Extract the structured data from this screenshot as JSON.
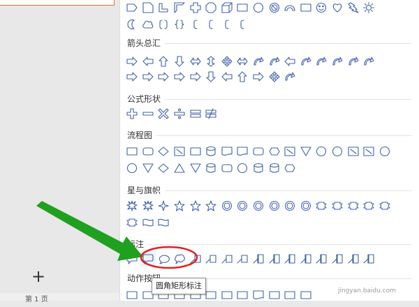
{
  "left_panel": {
    "add_label": "+",
    "bottom_text": "第 1 页"
  },
  "sections": [
    {
      "title": "",
      "rows": [
        [
          "rectangle-pentagon-icon",
          "snip-corner-icon",
          "l-shape-icon",
          "half-frame-icon",
          "cross-icon",
          "octagon-plaque-icon",
          "cube-icon",
          "bevel-icon",
          "donut-icon",
          "no-symbol-icon",
          "block-arc-icon",
          "folded-corner-icon",
          "smiley-icon",
          "heart-icon",
          "lightning-icon",
          "sun-icon"
        ],
        [
          "moon-icon",
          "cloud-icon",
          "double-bracket-icon",
          "double-brace-icon",
          "left-bracket-icon",
          "right-bracket-icon",
          "left-brace-icon",
          "right-brace-icon"
        ]
      ]
    },
    {
      "title": "箭头总汇",
      "rows": [
        [
          "right-arrow-icon",
          "left-arrow-icon",
          "up-arrow-icon",
          "down-arrow-icon",
          "left-right-arrow-icon",
          "up-down-arrow-icon",
          "quad-arrow-icon",
          "left-right-up-arrow-icon",
          "bent-arrow-icon",
          "u-turn-arrow-icon",
          "left-up-arrow-icon",
          "bent-up-arrow-icon",
          "curved-right-arrow-icon",
          "curved-left-arrow-icon",
          "curved-up-arrow-icon",
          "curved-down-arrow-icon"
        ],
        [
          "striped-right-arrow-icon",
          "notched-right-arrow-icon",
          "pentagon-arrow-icon",
          "chevron-arrow-icon",
          "right-callout-arrow-icon",
          "down-callout-arrow-icon",
          "left-callout-arrow-icon",
          "up-callout-arrow-icon",
          "left-right-callout-icon",
          "quad-callout-icon",
          "circular-arrow-icon"
        ]
      ]
    },
    {
      "title": "公式形状",
      "rows": [
        [
          "plus-icon",
          "minus-icon",
          "multiply-icon",
          "divide-icon",
          "equal-icon",
          "not-equal-icon"
        ]
      ]
    },
    {
      "title": "流程图",
      "rows": [
        [
          "process-icon",
          "alt-process-icon",
          "decision-icon",
          "data-icon",
          "predefined-process-icon",
          "internal-storage-icon",
          "document-icon",
          "multidocument-icon",
          "terminator-icon",
          "preparation-icon",
          "manual-input-icon",
          "manual-operation-icon",
          "connector-icon",
          "offpage-connector-icon",
          "punched-card-icon",
          "punched-tape-icon",
          "summing-junction-icon"
        ],
        [
          "or-icon",
          "collate-icon",
          "sort-icon",
          "extract-icon",
          "merge-icon",
          "stored-data-icon",
          "delay-icon",
          "sequential-storage-icon",
          "magnetic-disk-icon",
          "direct-storage-icon",
          "display-icon"
        ]
      ]
    },
    {
      "title": "星与旗帜",
      "rows": [
        [
          "explosion-1-icon",
          "explosion-2-icon",
          "star-4-icon",
          "star-5-icon",
          "star-6-icon",
          "star-7-icon",
          "star-8-icon",
          "star-10-icon",
          "star-12-icon",
          "star-16-icon",
          "star-24-icon",
          "star-32-icon",
          "ribbon-down-icon",
          "ribbon-up-icon",
          "curved-ribbon-down-icon",
          "curved-ribbon-up-icon",
          "vertical-scroll-icon"
        ],
        [
          "horizontal-scroll-icon",
          "wave-icon",
          "double-wave-icon"
        ]
      ]
    },
    {
      "title": "标注",
      "rows": [
        [
          "rect-callout-icon",
          "rounded-rect-callout-icon",
          "oval-callout-icon",
          "cloud-callout-icon",
          "line-callout-1-icon",
          "line-callout-2-icon",
          "line-callout-3-icon",
          "line-callout-4-icon",
          "accent-callout-1-icon",
          "accent-callout-2-icon",
          "accent-callout-3-icon",
          "accent-callout-4-icon",
          "border-callout-1-icon",
          "border-callout-2-icon",
          "border-callout-3-icon",
          "border-callout-4-icon"
        ]
      ]
    },
    {
      "title": "动作按钮",
      "rows": [
        [
          "action-back-icon",
          "action-forward-icon",
          "action-beginning-icon",
          "action-end-icon",
          "action-home-icon",
          "action-info-icon",
          "action-return-icon",
          "action-movie-icon",
          "action-document-icon",
          "action-sound-icon",
          "action-help-icon",
          "action-blank-icon"
        ]
      ]
    }
  ],
  "tooltip": "圆角矩形标注",
  "watermark": "jingyan.baidu.com",
  "colors": {
    "icon_stroke": "#3f62a8",
    "annotation_arrow": "#1fa01f",
    "annotation_circle": "#e02020"
  }
}
